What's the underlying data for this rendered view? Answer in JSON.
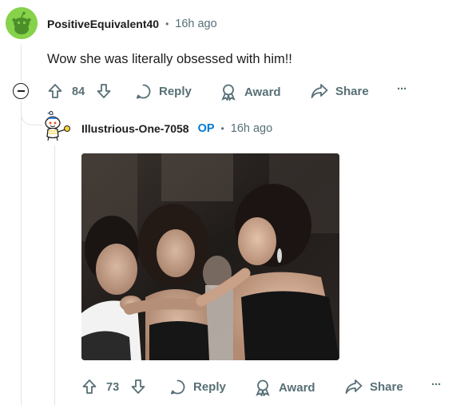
{
  "comment": {
    "username": "PositiveEquivalent40",
    "dot": "•",
    "time": "16h ago",
    "text": "Wow she was literally obsessed with him!!",
    "votes": "84",
    "reply_label": "Reply",
    "award_label": "Award",
    "share_label": "Share",
    "more_label": "···"
  },
  "reply": {
    "username": "Illustrious-One-7058",
    "op_badge": "OP",
    "dot": "•",
    "time": "16h ago",
    "votes": "73",
    "reply_label": "Reply",
    "award_label": "Award",
    "share_label": "Share",
    "more_label": "···"
  },
  "colors": {
    "meta": "#576f76",
    "op": "#0079d3",
    "avatar_green": "#86d24a"
  }
}
